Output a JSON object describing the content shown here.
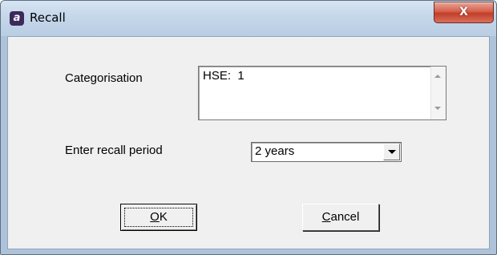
{
  "window": {
    "title": "Recall",
    "app_icon_letter": "a",
    "app_icon": "app-a-icon",
    "close_glyph": "X"
  },
  "form": {
    "categorisation_label": "Categorisation",
    "categorisation_value": "HSE:  1",
    "recall_period_label": "Enter recall period",
    "recall_period_value": "2 years"
  },
  "buttons": {
    "ok_mnemonic": "O",
    "ok_rest": "K",
    "cancel_mnemonic": "C",
    "cancel_rest": "ancel"
  },
  "colors": {
    "close_button": "#c9473a",
    "dialog_background": "#f0f0f0",
    "frame": "#b9cde3"
  }
}
